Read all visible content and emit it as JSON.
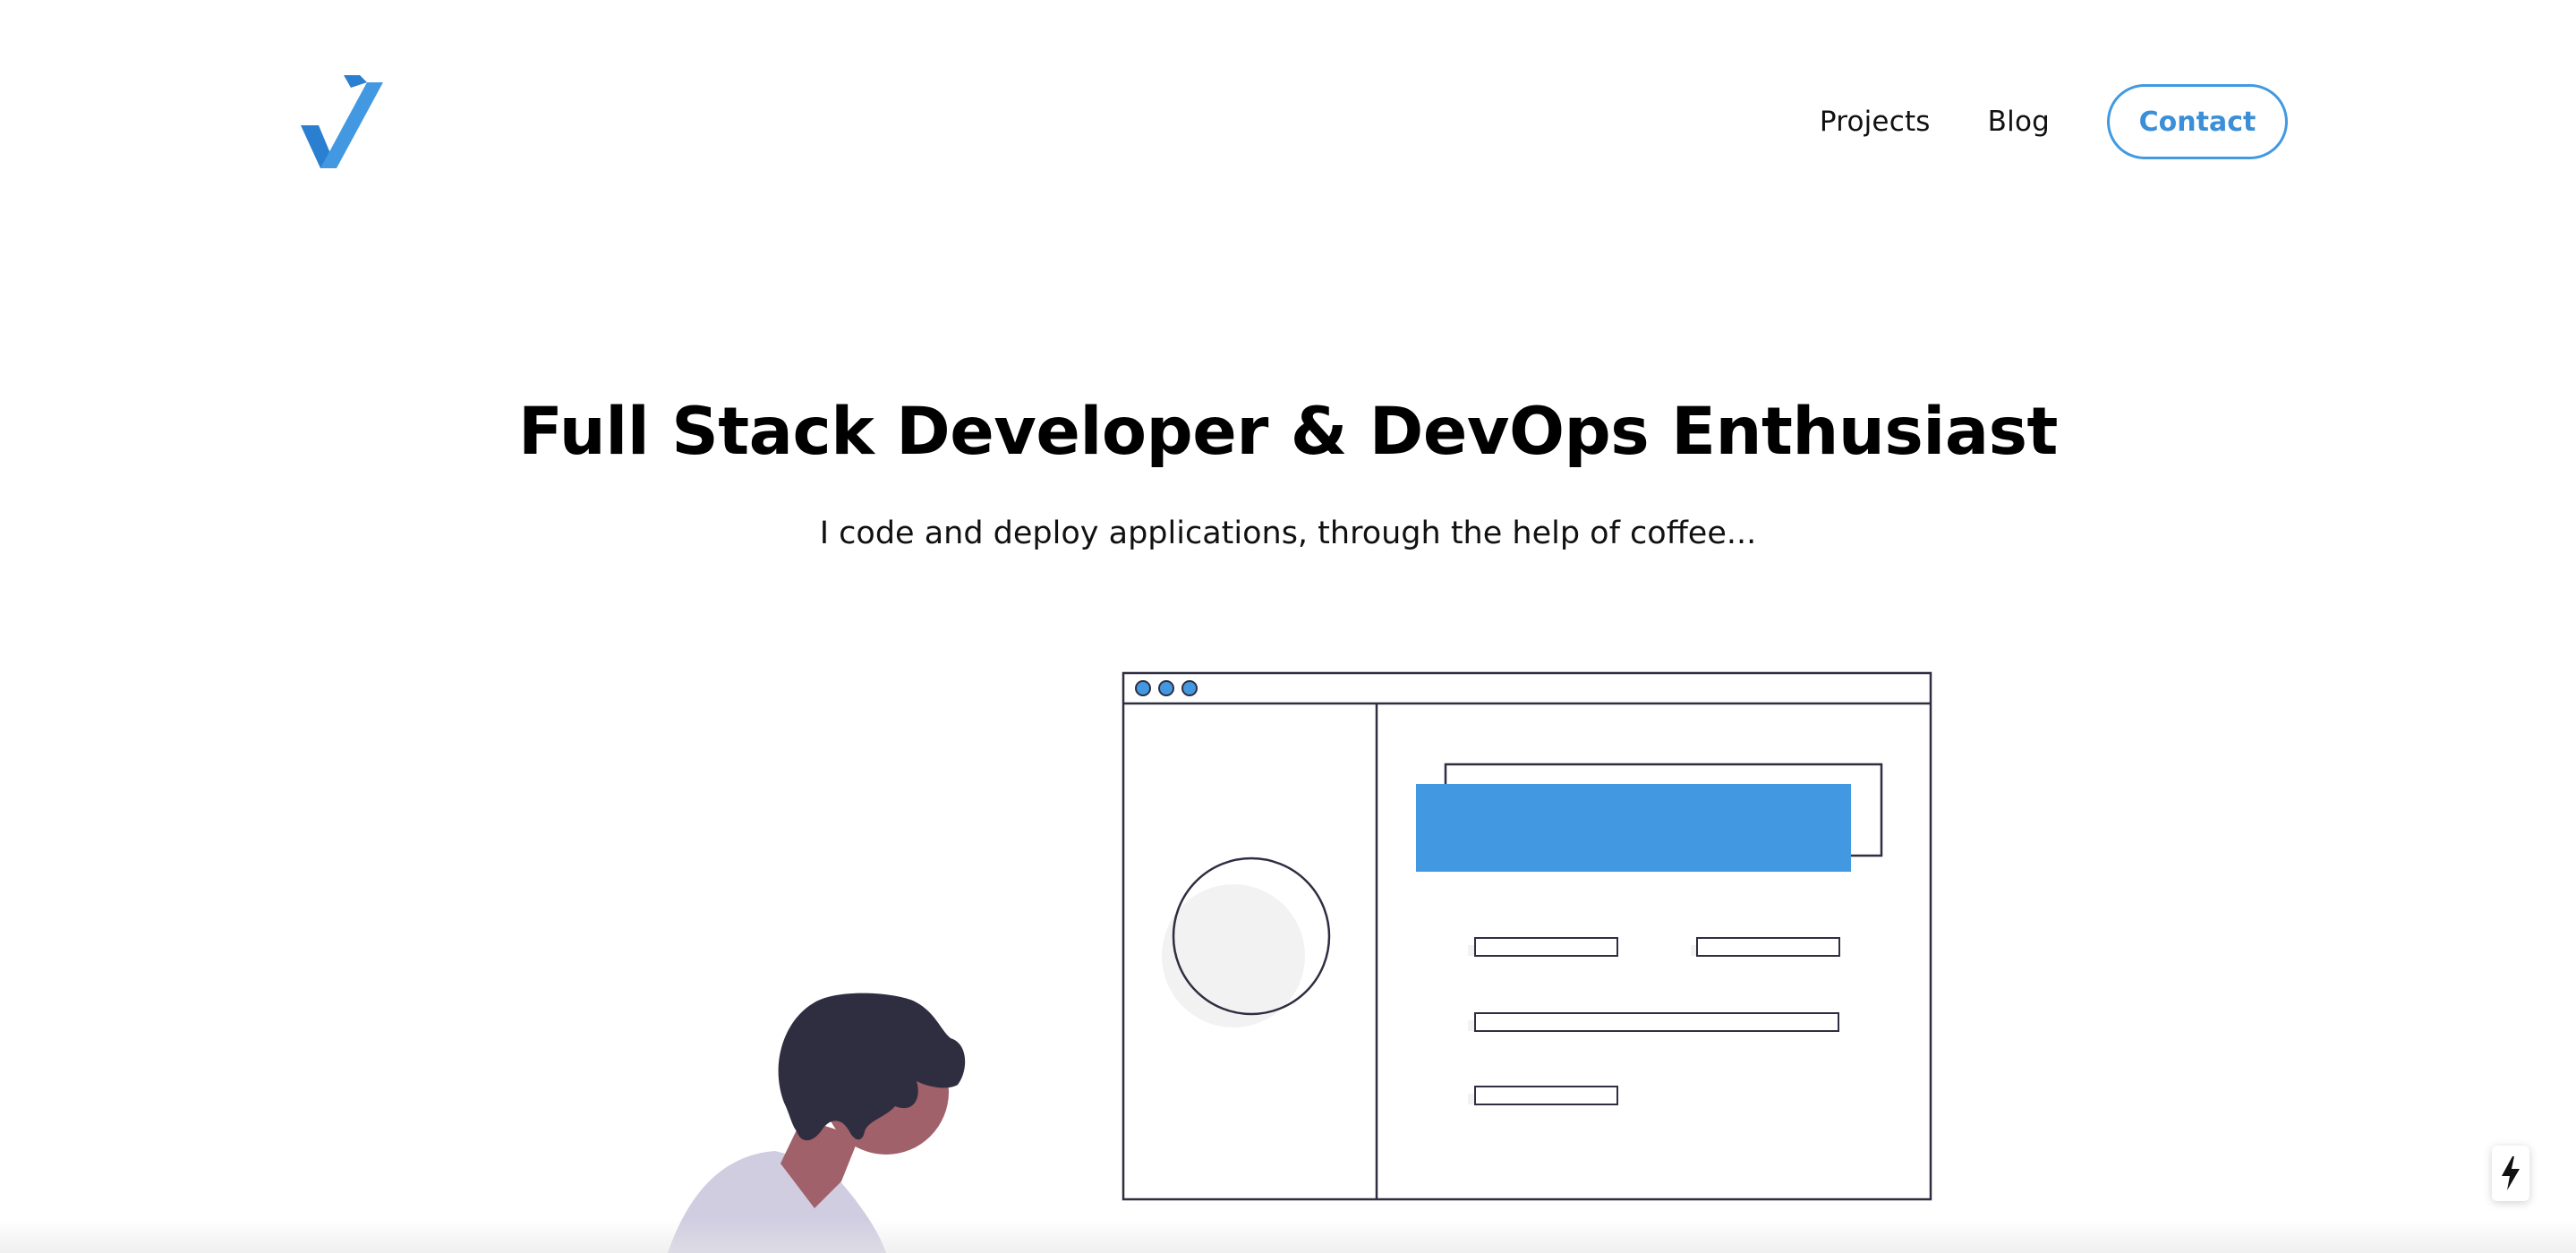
{
  "header": {
    "logo_icon": "checkmark-logo-icon",
    "nav": [
      {
        "label": "Projects"
      },
      {
        "label": "Blog"
      }
    ],
    "contact_label": "Contact"
  },
  "hero": {
    "title": "Full Stack Developer & DevOps Enthusiast",
    "subtitle": "I code and deploy applications, through the help of coffee..."
  },
  "colors": {
    "accent": "#4299e1",
    "dark": "#2f2e41",
    "skin": "#a0616a",
    "shirt": "#d0cde1",
    "placeholder": "#f2f2f2"
  },
  "icons": {
    "badge": "lightning-bolt-icon"
  }
}
